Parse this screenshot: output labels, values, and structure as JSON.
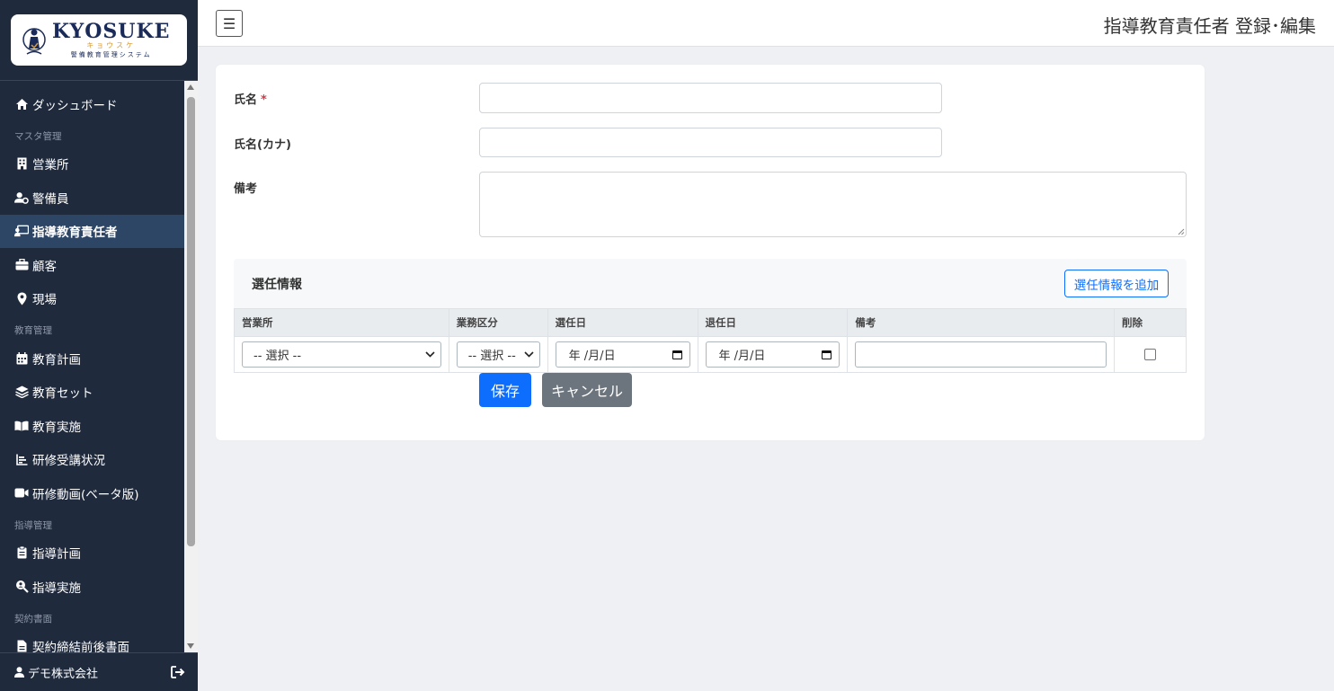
{
  "brand": {
    "title": "KYOSUKE",
    "kana": "キョウスケ",
    "subtitle": "警備教育管理システム"
  },
  "sidebar": {
    "items": [
      {
        "type": "item",
        "label": "ダッシュボード",
        "icon": "home-icon"
      },
      {
        "type": "heading",
        "label": "マスタ管理"
      },
      {
        "type": "item",
        "label": "営業所",
        "icon": "building-icon"
      },
      {
        "type": "item",
        "label": "警備員",
        "icon": "user-gear-icon"
      },
      {
        "type": "item",
        "label": "指導教育責任者",
        "icon": "chalkboard-teacher-icon",
        "active": true
      },
      {
        "type": "item",
        "label": "顧客",
        "icon": "briefcase-icon"
      },
      {
        "type": "item",
        "label": "現場",
        "icon": "location-pin-icon"
      },
      {
        "type": "heading",
        "label": "教育管理"
      },
      {
        "type": "item",
        "label": "教育計画",
        "icon": "calendar-icon"
      },
      {
        "type": "item",
        "label": "教育セット",
        "icon": "layers-icon"
      },
      {
        "type": "item",
        "label": "教育実施",
        "icon": "book-open-icon"
      },
      {
        "type": "item",
        "label": "研修受講状況",
        "icon": "chart-bar-icon"
      },
      {
        "type": "item",
        "label": "研修動画(ベータ版)",
        "icon": "video-icon"
      },
      {
        "type": "heading",
        "label": "指導管理"
      },
      {
        "type": "item",
        "label": "指導計画",
        "icon": "clipboard-icon"
      },
      {
        "type": "item",
        "label": "指導実施",
        "icon": "search-user-icon"
      },
      {
        "type": "heading",
        "label": "契約書面"
      },
      {
        "type": "item",
        "label": "契約締結前後書面",
        "icon": "file-icon"
      }
    ],
    "footer": {
      "company": "デモ株式会社",
      "logout_icon": "logout-icon"
    }
  },
  "header": {
    "menu_icon": "☰",
    "title": "指導教育責任者 登録･編集"
  },
  "form": {
    "name_label": "氏名",
    "required_mark": "*",
    "name_value": "",
    "kana_label": "氏名(カナ)",
    "kana_value": "",
    "note_label": "備考",
    "note_value": ""
  },
  "appointment": {
    "title": "選任情報",
    "add_button": "選任情報を追加",
    "columns": [
      "営業所",
      "業務区分",
      "選任日",
      "退任日",
      "備考",
      "削除"
    ],
    "row": {
      "office_select": "-- 選択 --",
      "category_select": "-- 選択 --",
      "appointed_date": "年 /月/日",
      "retired_date": "年 /月/日",
      "note": "",
      "delete": false
    }
  },
  "actions": {
    "save": "保存",
    "cancel": "キャンセル"
  }
}
